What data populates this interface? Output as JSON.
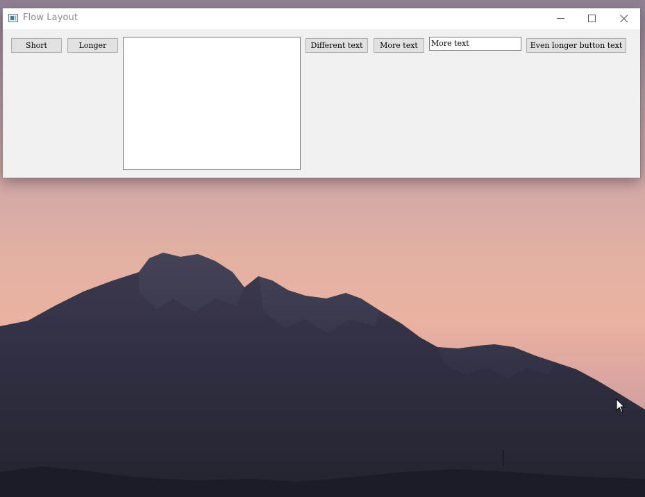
{
  "window": {
    "title": "Flow Layout",
    "app_icon": "window-app-icon",
    "controls": {
      "minimize_icon": "minimize-icon",
      "maximize_icon": "maximize-icon",
      "close_icon": "close-icon"
    }
  },
  "client": {
    "buttons": {
      "short": "Short",
      "longer": "Longer",
      "different_text": "Different text",
      "more_text": "More text",
      "even_longer": "Even longer button text"
    },
    "text_area": {
      "value": ""
    },
    "line_edit": {
      "value": "More text"
    }
  },
  "desktop": {
    "wallpaper": "mountain-at-dusk",
    "cursor_icon": "arrow-cursor-icon"
  },
  "colors": {
    "window_background": "#f0f0f0",
    "titlebar_background": "#ffffff",
    "button_face": "#e1e1e1",
    "button_border": "#adadad"
  }
}
